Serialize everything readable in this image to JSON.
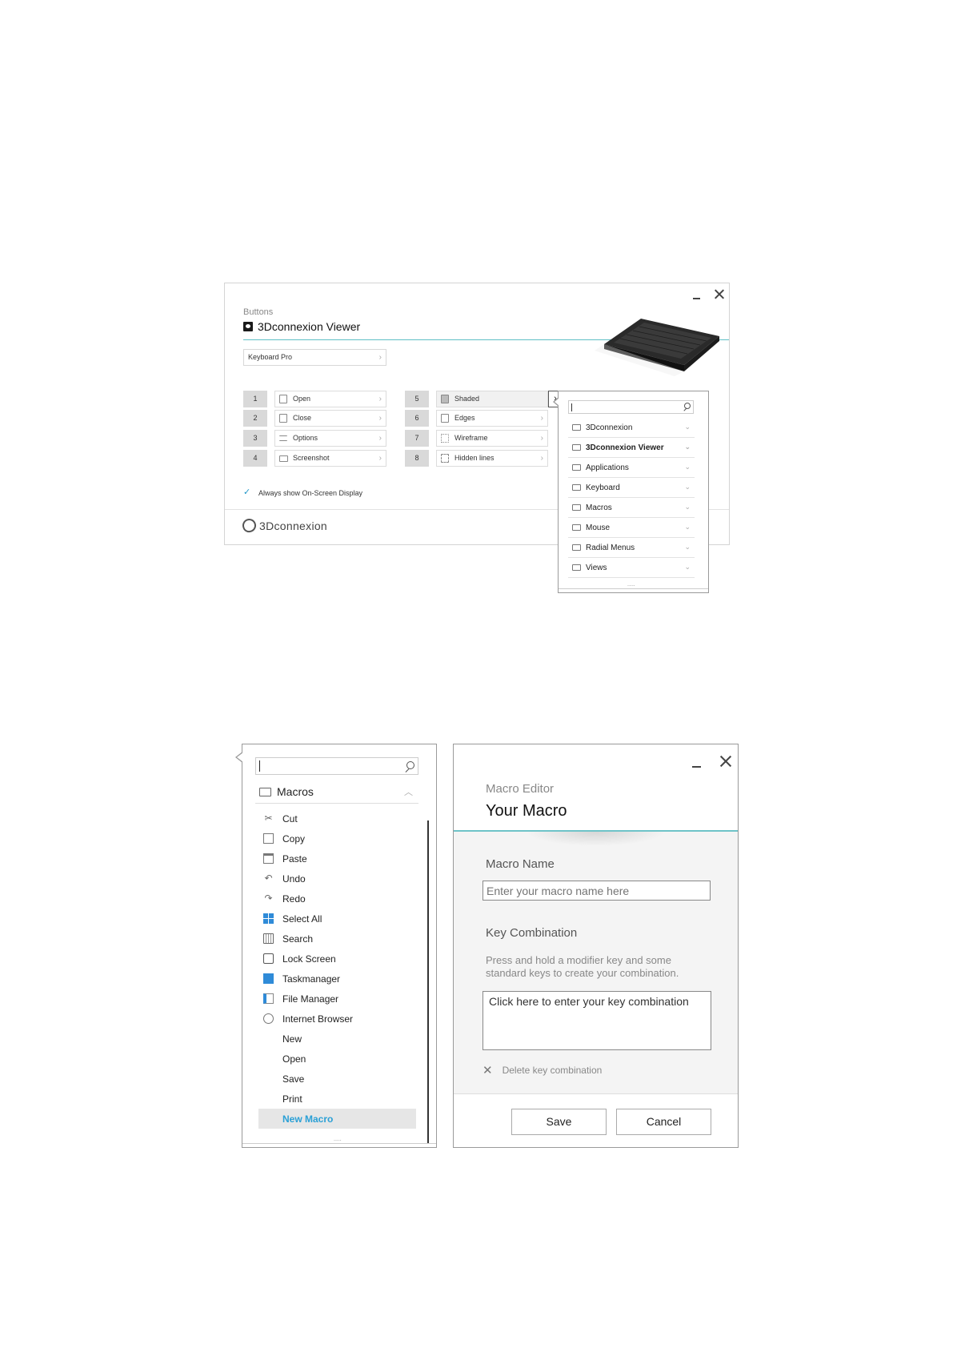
{
  "buttons_window": {
    "subtitle": "Buttons",
    "title": "3Dconnexion Viewer",
    "device_dropdown": "Keyboard Pro",
    "buttons": [
      {
        "num": "1",
        "label": "Open",
        "icon": "open-file-icon"
      },
      {
        "num": "2",
        "label": "Close",
        "icon": "close-file-icon"
      },
      {
        "num": "3",
        "label": "Options",
        "icon": "options-icon"
      },
      {
        "num": "4",
        "label": "Screenshot",
        "icon": "camera-icon"
      },
      {
        "num": "5",
        "label": "Shaded",
        "icon": "shaded-cube-icon"
      },
      {
        "num": "6",
        "label": "Edges",
        "icon": "edges-cube-icon"
      },
      {
        "num": "7",
        "label": "Wireframe",
        "icon": "wireframe-cube-icon"
      },
      {
        "num": "8",
        "label": "Hidden lines",
        "icon": "hidden-lines-cube-icon"
      }
    ],
    "checkbox_label": "Always show On-Screen Display",
    "checkbox_checked": true,
    "logo_text": "3Dconnexion",
    "accent_color": "#5fbfc5"
  },
  "assign_popup": {
    "search_placeholder": "",
    "folders": [
      "3Dconnexion",
      "3Dconnexion Viewer",
      "Applications",
      "Keyboard",
      "Macros",
      "Mouse",
      "Radial Menus",
      "Views"
    ],
    "bold_folder": "3Dconnexion Viewer"
  },
  "macros_popup": {
    "header": "Macros",
    "items": [
      {
        "label": "Cut",
        "icon": "scissors-icon"
      },
      {
        "label": "Copy",
        "icon": "copy-icon"
      },
      {
        "label": "Paste",
        "icon": "paste-icon"
      },
      {
        "label": "Undo",
        "icon": "undo-icon"
      },
      {
        "label": "Redo",
        "icon": "redo-icon"
      },
      {
        "label": "Select All",
        "icon": "windows-grid-icon"
      },
      {
        "label": "Search",
        "icon": "keyboard-icon"
      },
      {
        "label": "Lock Screen",
        "icon": "lock-icon"
      },
      {
        "label": "Taskmanager",
        "icon": "taskmanager-icon"
      },
      {
        "label": "File Manager",
        "icon": "file-manager-icon"
      },
      {
        "label": "Internet Browser",
        "icon": "globe-icon"
      },
      {
        "label": "New",
        "icon": ""
      },
      {
        "label": "Open",
        "icon": ""
      },
      {
        "label": "Save",
        "icon": ""
      },
      {
        "label": "Print",
        "icon": ""
      },
      {
        "label": "New Macro",
        "icon": ""
      }
    ],
    "selected_item": "New Macro",
    "selected_color": "#2aa0d6"
  },
  "macro_editor": {
    "subtitle": "Macro Editor",
    "title": "Your Macro",
    "name_label": "Macro Name",
    "name_placeholder": "Enter your macro name here",
    "key_label": "Key Combination",
    "help_text": "Press and hold a modifier key and some standard keys to create your combination.",
    "key_placeholder": "Click here to enter your key combination",
    "delete_label": "Delete key combination",
    "save_label": "Save",
    "cancel_label": "Cancel"
  }
}
